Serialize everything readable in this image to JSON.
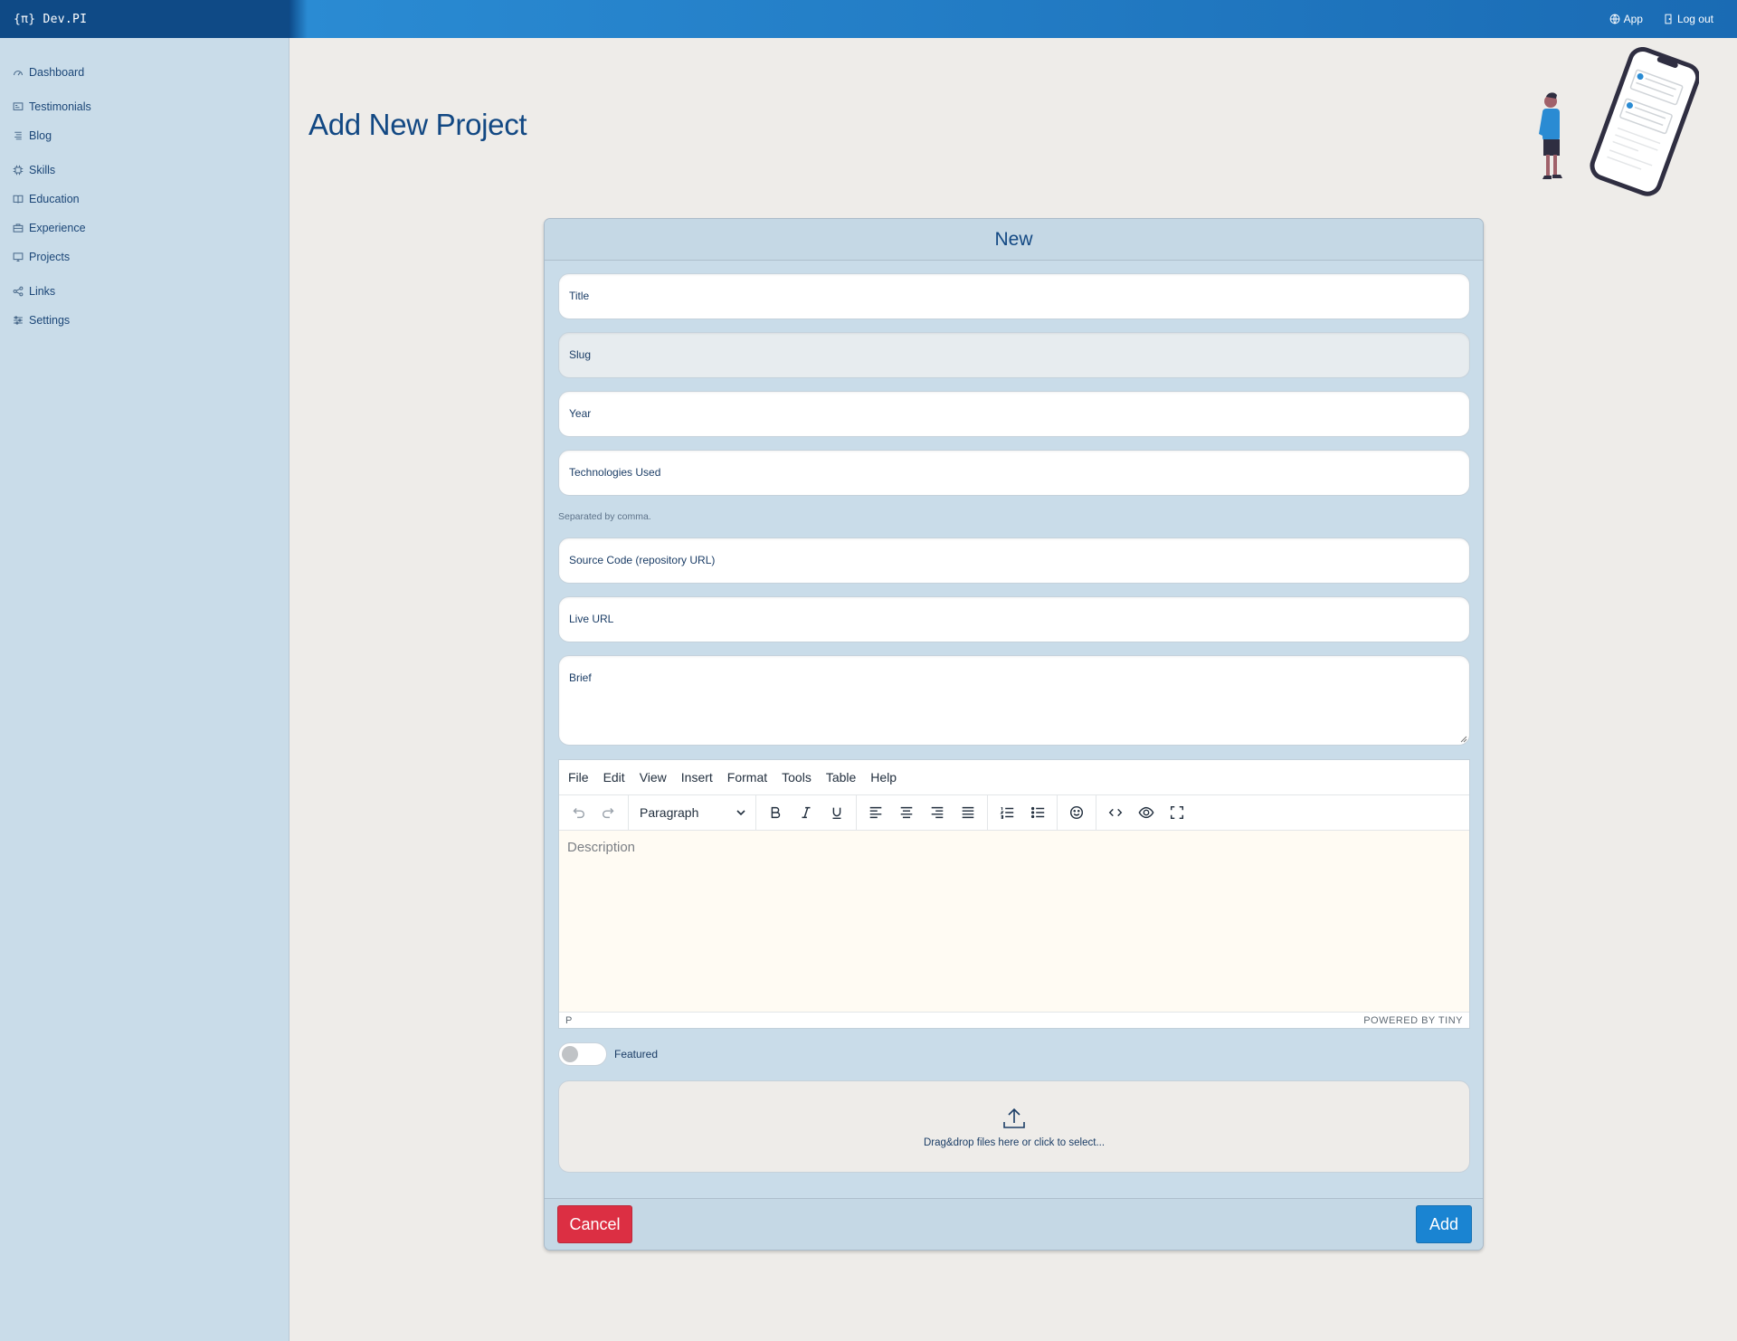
{
  "brand": "{π} Dev.PI",
  "topnav": {
    "app_label": "App",
    "logout_label": "Log out"
  },
  "sidebar": {
    "items": [
      {
        "label": "Dashboard",
        "icon": "gauge-icon"
      },
      {
        "label": "Testimonials",
        "icon": "quote-icon"
      },
      {
        "label": "Blog",
        "icon": "blog-icon"
      },
      {
        "label": "Skills",
        "icon": "cpu-icon"
      },
      {
        "label": "Education",
        "icon": "book-icon"
      },
      {
        "label": "Experience",
        "icon": "briefcase-icon"
      },
      {
        "label": "Projects",
        "icon": "monitor-icon"
      },
      {
        "label": "Links",
        "icon": "share-icon"
      },
      {
        "label": "Settings",
        "icon": "sliders-icon"
      }
    ]
  },
  "page": {
    "title": "Add New Project"
  },
  "card": {
    "header": "New",
    "fields": {
      "title": "Title",
      "slug": "Slug",
      "year": "Year",
      "technologies": "Technologies Used",
      "technologies_help": "Separated by comma.",
      "source": "Source Code (repository URL)",
      "live": "Live URL",
      "brief": "Brief"
    },
    "editor": {
      "menu": [
        "File",
        "Edit",
        "View",
        "Insert",
        "Format",
        "Tools",
        "Table",
        "Help"
      ],
      "block_format": "Paragraph",
      "placeholder": "Description",
      "status_path": "P",
      "powered": "POWERED BY TINY"
    },
    "featured_label": "Featured",
    "featured_on": false,
    "dropzone_text": "Drag&drop files here or click to select...",
    "cancel_label": "Cancel",
    "add_label": "Add"
  },
  "colors": {
    "primary": "#124883",
    "sidebar_bg": "#c9dce9",
    "cancel": "#dc2f43",
    "add": "#1a84d2"
  }
}
